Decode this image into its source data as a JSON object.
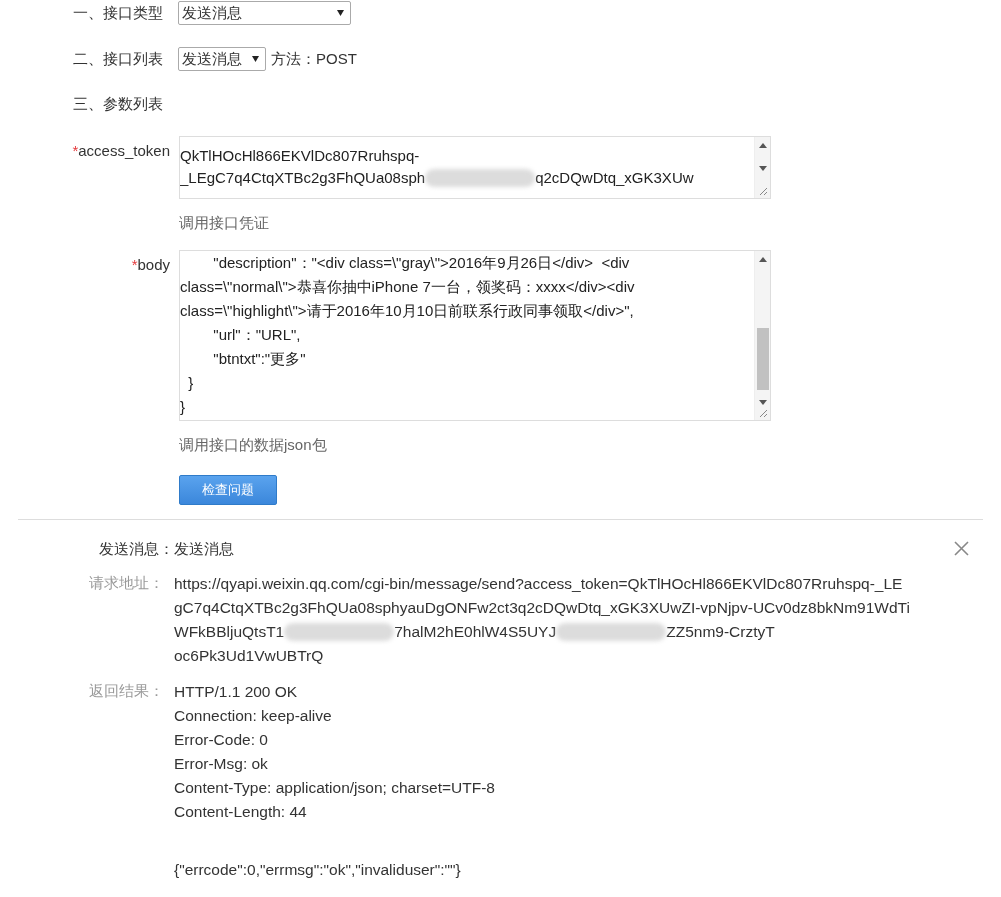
{
  "form": {
    "rows": [
      {
        "label": "一、接口类型",
        "kind": "select",
        "value": "发送消息",
        "wide": true
      },
      {
        "label": "二、接口列表",
        "kind": "select",
        "value": "发送消息",
        "wide": false,
        "suffix": "方法：POST"
      },
      {
        "label": "三、参数列表",
        "kind": "heading"
      }
    ],
    "params": [
      {
        "marker": "*",
        "name": "access_token",
        "lines": [
          [
            {
              "kind": "text",
              "text": "QkTlHOcHl866EKVlDc807Rruhspq-"
            }
          ],
          [
            {
              "kind": "text",
              "text": "_LEgC7q4CtqXTBc2g3FhQUa08sph"
            },
            {
              "kind": "blur"
            },
            {
              "kind": "text",
              "text": "q2cDQwDtq_xGK3XUw"
            }
          ]
        ],
        "hint": "调用接口凭证",
        "tall": false
      },
      {
        "marker": "*",
        "name": "body",
        "lines": [
          [
            {
              "kind": "text",
              "text": "        \"description\"：\"<div class=\\\"gray\\\">2016年9月26日</div>  <div"
            }
          ],
          [
            {
              "kind": "text",
              "text": "class=\\\"normal\\\">恭喜你抽中iPhone 7一台，领奖码：xxxx</div><div"
            }
          ],
          [
            {
              "kind": "text",
              "text": "class=\\\"highlight\\\">请于2016年10月10日前联系行政同事领取</div>\","
            }
          ],
          [
            {
              "kind": "text",
              "text": "        \"url\"：\"URL\","
            }
          ],
          [
            {
              "kind": "text",
              "text": "        \"btntxt\":\"更多\""
            }
          ],
          [
            {
              "kind": "text",
              "text": "  }"
            }
          ],
          [
            {
              "kind": "text",
              "text": "}"
            }
          ]
        ],
        "hint": "调用接口的数据json包",
        "tall": true
      }
    ],
    "submit": "检查问题"
  },
  "result": {
    "title": "发送消息：发送消息",
    "request_label": "请求地址：",
    "request_lines": [
      [
        {
          "kind": "text",
          "text": "https://qyapi.weixin.qq.com/cgi-bin/message/send?access_token=QkTlHOcHl866EKVlDc807Rruhspq-_LE"
        }
      ],
      [
        {
          "kind": "text",
          "text": "gC7q4CtqXTBc2g3FhQUa08sphyauDgONFw2ct3q2cDQwDtq_xGK3XUwZI-vpNjpv-UCv0dz8bkNm91WdTi"
        }
      ],
      [
        {
          "kind": "text",
          "text": "WFkBBljuQtsT1"
        },
        {
          "kind": "blur"
        },
        {
          "kind": "text",
          "text": "7halM2hE0hlW4S5UYJ"
        },
        {
          "kind": "blur"
        },
        {
          "kind": "text",
          "text": "ZZ5nm9-CrztyT"
        }
      ],
      [
        {
          "kind": "text",
          "text": "oc6Pk3Ud1VwUBTrQ"
        }
      ]
    ],
    "response_label": "返回结果：",
    "response_lines": [
      "HTTP/1.1 200 OK",
      "Connection: keep-alive",
      "Error-Code: 0",
      "Error-Msg: ok",
      "Content-Type: application/json; charset=UTF-8",
      "Content-Length: 44"
    ],
    "response_body": "{\"errcode\":0,\"errmsg\":\"ok\",\"invaliduser\":\"\"}"
  }
}
